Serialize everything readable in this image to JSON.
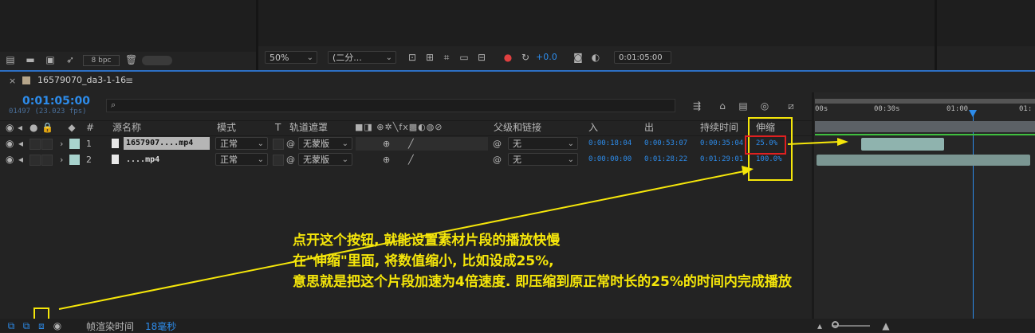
{
  "top_toolbar": {
    "bpc_label": "8 bpc",
    "zoom_value": "50%",
    "resolution_value": "(二分...",
    "exposure_value": "+0.0",
    "timecode_value": "0:01:05:00"
  },
  "comp_tab": {
    "title": "16579070_da3-1-16",
    "menu_glyph": "≡",
    "close_glyph": "×"
  },
  "time": {
    "current": "0:01:05:00",
    "frames": "01497 (23.023 fps)",
    "search_placeholder": ""
  },
  "columns": {
    "hash": "#",
    "source_name": "源名称",
    "mode": "模式",
    "t": "T",
    "track_matte": "轨道遮罩",
    "parent": "父级和链接",
    "in": "入",
    "out": "出",
    "duration": "持续时间",
    "stretch": "伸缩"
  },
  "layers": [
    {
      "index": "1",
      "name": "1657907....mp4",
      "mode": "正常",
      "matte": "无蒙版",
      "parent": "无",
      "in": "0:00:18:04",
      "out": "0:00:53:07",
      "duration": "0:00:35:04",
      "stretch": "25.0%"
    },
    {
      "index": "2",
      "name": "....mp4",
      "mode": "正常",
      "matte": "无蒙版",
      "parent": "无",
      "in": "0:00:00:00",
      "out": "0:01:28:22",
      "duration": "0:01:29:01",
      "stretch": "100.0%"
    }
  ],
  "timeline_ruler": {
    "labels": [
      "00s",
      "00:30s",
      "01:00",
      "01:"
    ]
  },
  "footer": {
    "render_time_label": "帧渲染时间",
    "render_time_value": "18毫秒"
  },
  "annotation": {
    "line1": "点开这个按钮, 就能设置素材片段的播放快慢",
    "line2": "在\"伸缩\"里面, 将数值缩小, 比如设成25%,",
    "line3": "意思就是把这个片段加速为4倍速度. 即压缩到原正常时长的25%的时间内完成播放"
  },
  "colors": {
    "accent_blue": "#2d8ceb",
    "annotation_yellow": "#f5e60a",
    "highlight_red": "#e02020",
    "layer_label": "#a8d3cd"
  }
}
